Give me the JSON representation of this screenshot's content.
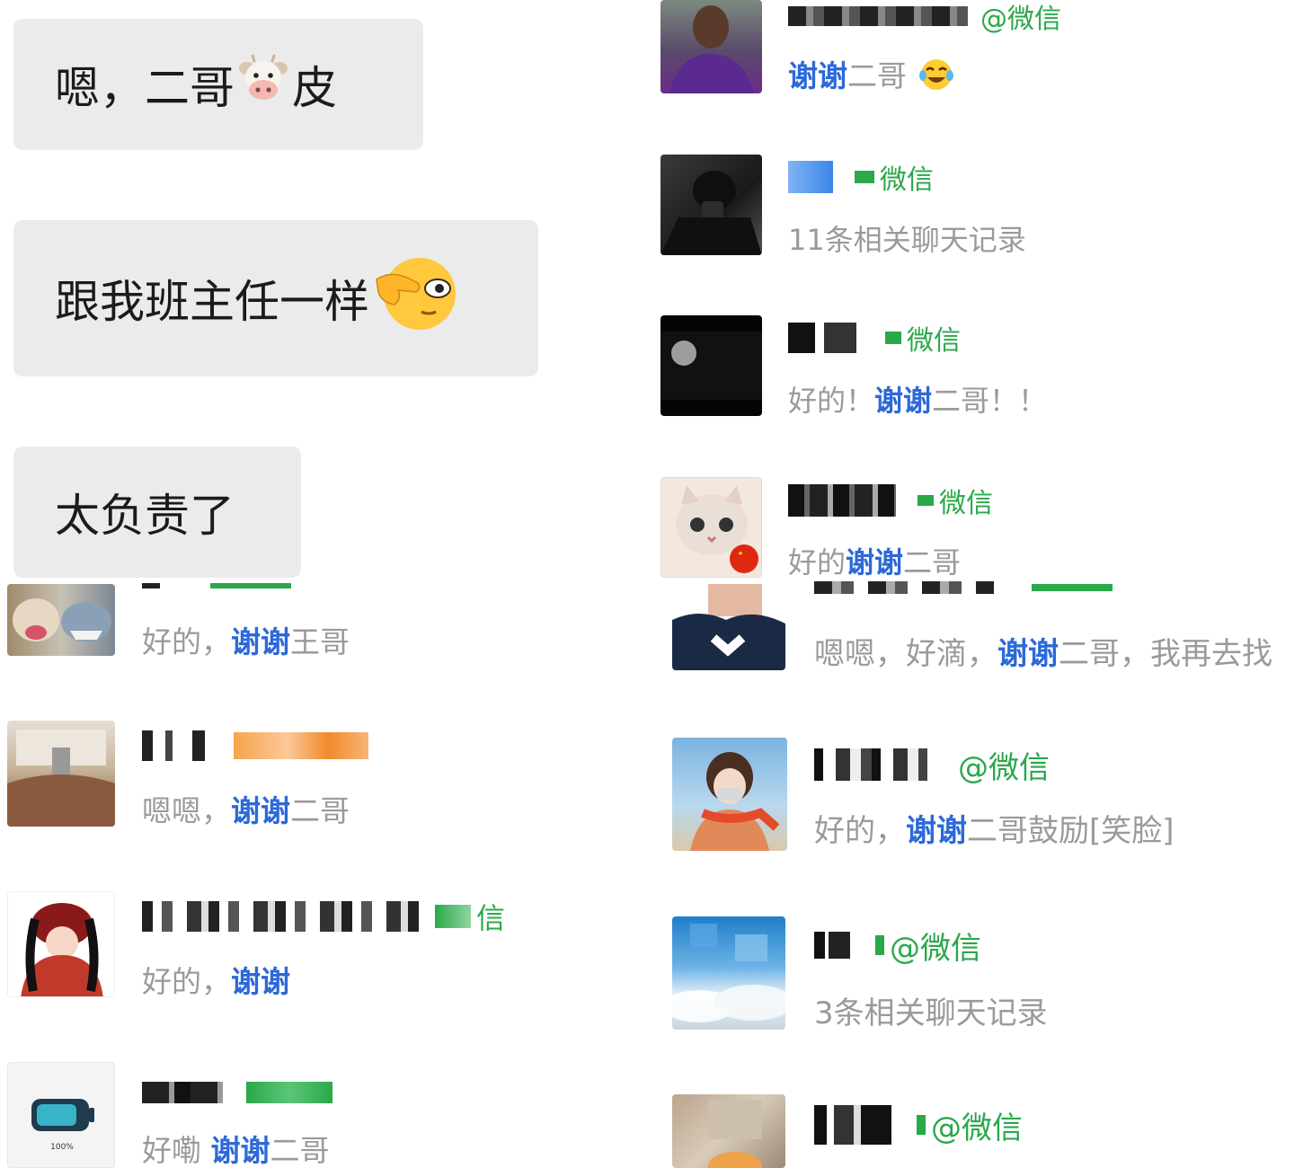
{
  "bubbles": [
    {
      "text_before": "嗯，二哥",
      "emoji": "cow-face",
      "text_after": "皮"
    },
    {
      "text_before": "跟我班主任一样",
      "emoji": "peeking-face",
      "text_after": ""
    },
    {
      "text_before": "太负责了",
      "emoji": "",
      "text_after": ""
    }
  ],
  "source_label": "微信",
  "source_label_at": "@微信",
  "right_contacts": [
    {
      "msg_parts": [
        "谢谢",
        "二哥"
      ],
      "hl": [
        0
      ],
      "emoji": "tears-of-joy"
    },
    {
      "msg_parts": [
        "11条相关聊天记录"
      ],
      "hl": []
    },
    {
      "msg_parts": [
        "好的！",
        "谢谢",
        "二哥！！"
      ],
      "hl": [
        1
      ]
    },
    {
      "msg_parts": [
        "好的",
        "谢谢",
        "二哥"
      ],
      "hl": [
        1
      ]
    }
  ],
  "left_contacts": [
    {
      "msg_parts": [
        "好的，",
        "谢谢",
        "王哥"
      ],
      "hl": [
        1
      ]
    },
    {
      "msg_parts": [
        "嗯嗯，",
        "谢谢",
        "二哥"
      ],
      "hl": [
        1
      ]
    },
    {
      "msg_parts": [
        "好的，",
        "谢谢"
      ],
      "hl": [
        1
      ]
    },
    {
      "msg_parts": [
        "好嘞 ",
        "谢谢",
        "二哥"
      ],
      "hl": [
        1
      ]
    }
  ],
  "right_lower_contacts": [
    {
      "msg_parts": [
        "嗯嗯，好滴，",
        "谢谢",
        "二哥，我再去找"
      ],
      "hl": [
        1
      ]
    },
    {
      "msg_parts": [
        "好的，",
        "谢谢",
        "二哥鼓励[笑脸]"
      ],
      "hl": [
        1
      ]
    },
    {
      "msg_parts": [
        "3条相关聊天记录"
      ],
      "hl": []
    },
    {
      "msg_parts": [],
      "hl": []
    }
  ],
  "battery_text": "100%",
  "colors": {
    "highlight": "#2c69d9",
    "source_green": "#2aa84a",
    "muted": "#9a9a9a",
    "bubble": "#ebebeb"
  }
}
